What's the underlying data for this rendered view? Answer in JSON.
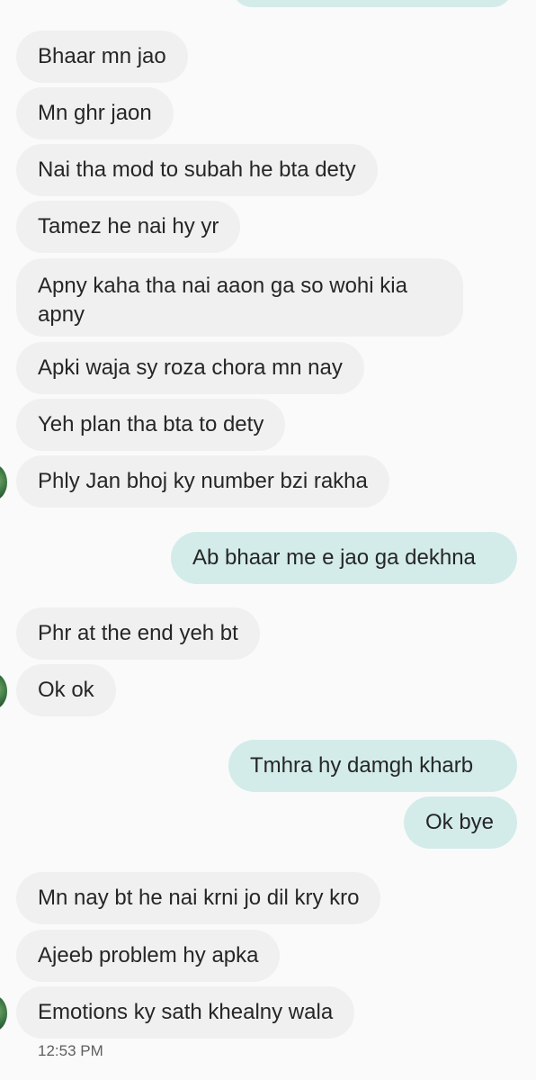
{
  "colors": {
    "incoming_bubble": "#f0f0f0",
    "outgoing_bubble": "#d3ecea",
    "background": "#fafafa",
    "text": "#262626"
  },
  "icons": {
    "avatar": "profile-avatar-icon"
  },
  "messages": [
    {
      "direction": "incoming",
      "text": "Bhaar mn jao"
    },
    {
      "direction": "incoming",
      "text": "Mn ghr jaon"
    },
    {
      "direction": "incoming",
      "text": "Nai tha mod to subah he bta dety"
    },
    {
      "direction": "incoming",
      "text": "Tamez he nai hy yr"
    },
    {
      "direction": "incoming",
      "text": "Apny kaha tha nai aaon ga so wohi kia apny"
    },
    {
      "direction": "incoming",
      "text": "Apki waja sy roza chora mn nay"
    },
    {
      "direction": "incoming",
      "text": "Yeh plan tha bta to dety"
    },
    {
      "direction": "incoming",
      "text": "Phly Jan bhoj ky number bzi rakha"
    },
    {
      "direction": "outgoing",
      "text": "Ab bhaar me e jao ga dekhna"
    },
    {
      "direction": "incoming",
      "text": "Phr at the end yeh bt"
    },
    {
      "direction": "incoming",
      "text": "Ok ok"
    },
    {
      "direction": "outgoing",
      "text": "Tmhra hy damgh kharb"
    },
    {
      "direction": "outgoing",
      "text": "Ok bye"
    },
    {
      "direction": "incoming",
      "text": "Mn nay bt he nai krni jo dil kry kro"
    },
    {
      "direction": "incoming",
      "text": "Ajeeb problem hy apka"
    },
    {
      "direction": "incoming",
      "text": "Emotions ky sath khealny wala"
    }
  ],
  "timestamp": "12:53 PM"
}
